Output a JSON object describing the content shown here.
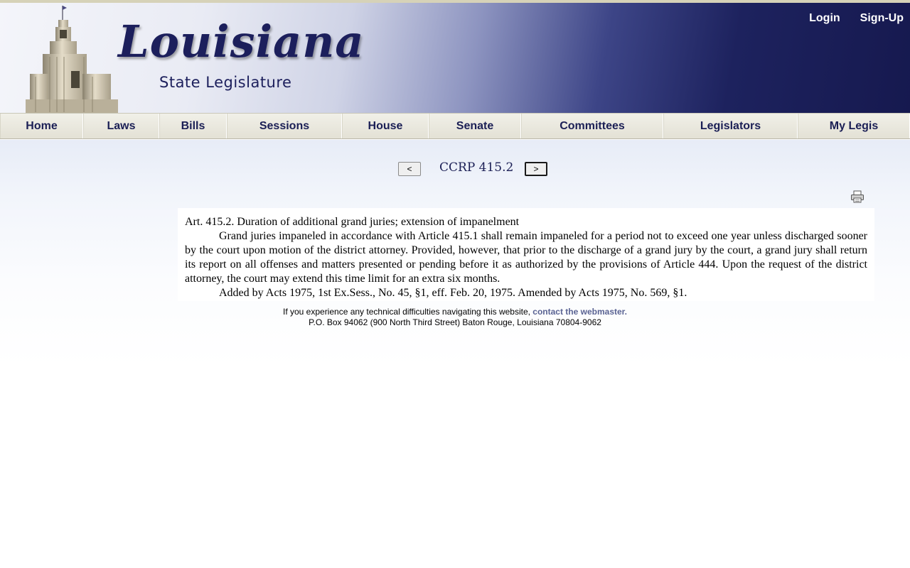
{
  "header": {
    "logo_title": "Louisiana",
    "logo_subtitle": "State Legislature",
    "login_label": "Login",
    "signup_label": "Sign-Up"
  },
  "nav": {
    "items": [
      {
        "label": "Home"
      },
      {
        "label": "Laws"
      },
      {
        "label": "Bills"
      },
      {
        "label": "Sessions"
      },
      {
        "label": "House"
      },
      {
        "label": "Senate"
      },
      {
        "label": "Committees"
      },
      {
        "label": "Legislators"
      },
      {
        "label": "My Legis"
      }
    ]
  },
  "pager": {
    "prev_label": "<",
    "title": "CCRP 415.2",
    "next_label": ">"
  },
  "document": {
    "heading": "Art. 415.2.  Duration of additional grand juries; extension of impanelment",
    "body": "Grand juries impaneled in accordance with Article 415.1 shall remain impaneled for a period not to exceed one year unless discharged sooner by the court upon motion of the district attorney.  Provided, however, that prior to the discharge of a grand jury by the court, a grand jury shall return its report on all offenses and matters presented or pending before it as authorized by the provisions of Article 444.  Upon the request of the district attorney, the court may extend this time limit for an extra six months.",
    "history": "Added by Acts 1975, 1st Ex.Sess., No. 45, §1, eff. Feb. 20, 1975.  Amended by Acts 1975, No. 569, §1."
  },
  "footer": {
    "line1_text": "If you experience any technical difficulties navigating this website, ",
    "line1_link": "contact the webmaster.",
    "line2": "P.O. Box 94062 (900 North Third Street) Baton Rouge, Louisiana 70804-9062"
  },
  "icons": {
    "print": "printer-icon",
    "capitol": "capitol-building-icon"
  },
  "colors": {
    "brand_navy": "#1c1f5c",
    "nav_text": "#1b1f55",
    "link": "#5a6393"
  }
}
